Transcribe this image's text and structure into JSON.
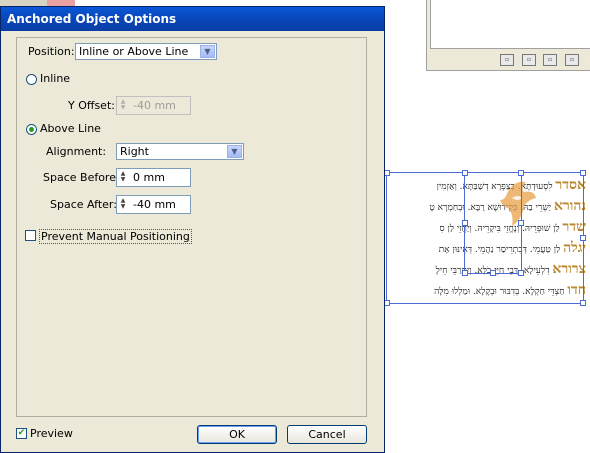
{
  "dialog": {
    "title": "Anchored Object Options",
    "position_label": "Position:",
    "position_value": "Inline or Above Line",
    "inline_label": "Inline",
    "y_offset_label": "Y Offset:",
    "y_offset_value": "-40 mm",
    "above_line_label": "Above Line",
    "alignment_label": "Alignment:",
    "alignment_value": "Right",
    "space_before_label": "Space Before:",
    "space_before_value": "0 mm",
    "space_after_label": "Space After:",
    "space_after_value": "-40 mm",
    "prevent_label": "Prevent Manual Positioning",
    "preview_label": "Preview",
    "ok_label": "OK",
    "cancel_label": "Cancel",
    "selected_radio": "above-line",
    "preview_checked": true,
    "prevent_checked": false
  },
  "hebrew_lines": [
    {
      "big": "אסדר",
      "text": "לִסְעוּדְתָא. בְּצַפְרָא דְשַׁבַּתָּא. וְאַזְמִין"
    },
    {
      "big": "נהורא",
      "text": "יַשְׁרֵי בַהּ. בְּקִידוּשָׁא רַבָּא. וּבְחַמְרָא טָ"
    },
    {
      "big": "שדר",
      "text": "לַן שׁוּפְרֵיהּ. וְנֶחֱזֵי בִּיקָרֵיהּ. וְיַחֲזֵי לַן סִ"
    },
    {
      "big": "יגלה",
      "text": "לַן טַעֲמֵי. דְּבִתְרֵיסַר נַהֲמֵי. דְּאִינּוּן אָת"
    },
    {
      "big": "צרורא",
      "text": "דִלְעֵילָא. דְּבֵי חַיֵּי כֹלָּא. וְיִתְרַבֵּי חֵילָ"
    },
    {
      "big": "חדו",
      "text": "חַצְדֵּי חַקְלָא. בְּדִבּוּר וּבְקָלָא. וּמַלְלוּ מִלָּה"
    }
  ],
  "colors": {
    "titlebar": "#0a4fc4",
    "dialog_bg": "#ece9d8",
    "frame_border": "#4b6bd6",
    "hebrew_accent": "#b8862c"
  }
}
